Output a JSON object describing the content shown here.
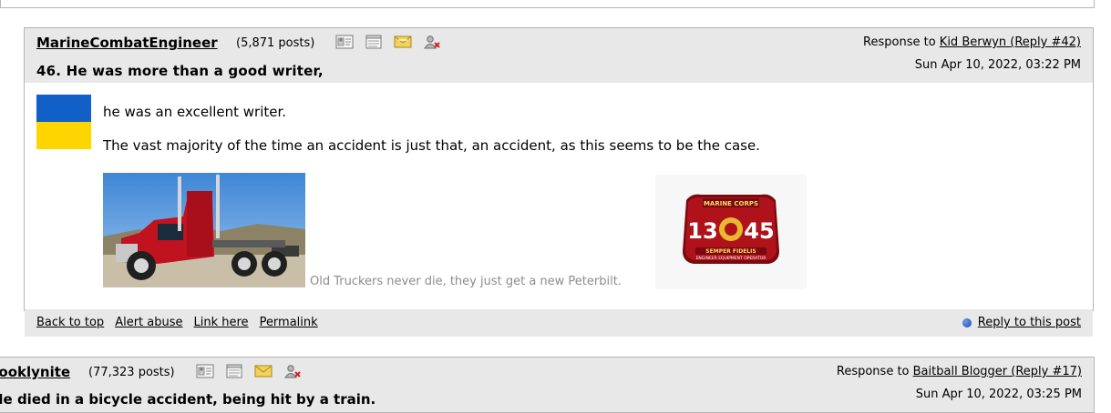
{
  "post": {
    "author": "MarineCombatEngineer",
    "post_count": "(5,871 posts)",
    "subject": "46. He was more than a good writer,",
    "response_prefix": "Response to ",
    "response_link": "Kid Berwyn (Reply #42)",
    "date": "Sun Apr 10, 2022, 03:22 PM",
    "lines": [
      "he was an excellent writer.",
      "The vast majority of the time an accident is just that, an accident, as this seems to be the case."
    ],
    "caption": "Old Truckers never die, they just get a new Peterbilt.",
    "badge": {
      "top_text": "MARINE CORPS",
      "number_left": "13",
      "number_right": "45",
      "motto": "SEMPER FIDELIS",
      "bottom_text": "ENGINEER EQUIPMENT OPERATOR"
    },
    "footer": {
      "back_to_top": "Back to top",
      "alert_abuse": "Alert abuse",
      "link_here": "Link here",
      "permalink": "Permalink",
      "reply": "Reply to this post"
    },
    "icons": [
      "profile-icon",
      "journal-icon",
      "mail-icon",
      "ignore-icon"
    ]
  },
  "post2": {
    "author": "rooklynite",
    "post_count": "(77,323 posts)",
    "subject": "He died in a bicycle accident, being hit by a train.",
    "response_prefix": "Response to ",
    "response_link": "Baitball Blogger (Reply #17)",
    "date": "Sun Apr 10, 2022, 03:25 PM"
  },
  "colors": {
    "header_bg": "#e8e8e8",
    "border": "#b4b4b4",
    "flag_blue": "#1060c8",
    "flag_yellow": "#ffd500",
    "caption": "#8c8c8c",
    "badge_red": "#b0121b"
  }
}
